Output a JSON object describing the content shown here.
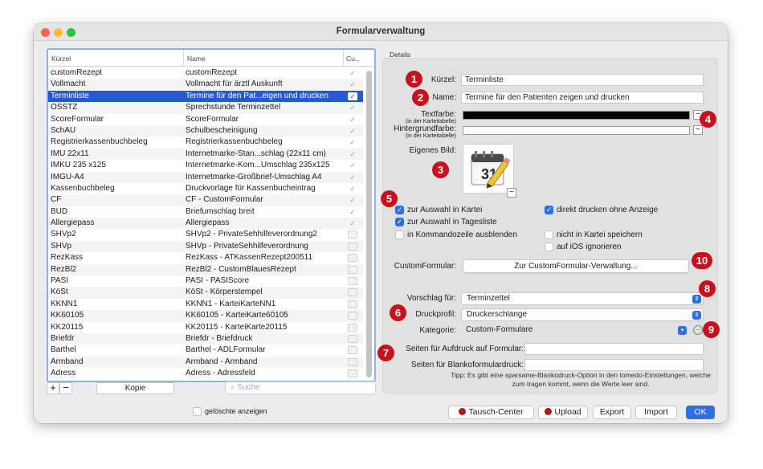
{
  "window": {
    "title": "Formularverwaltung"
  },
  "colors": {
    "close": "#fe5f57",
    "minimize": "#febc2e",
    "zoom": "#28c840",
    "accent": "#2f6fe0",
    "badge": "#c8101f",
    "selected_row": "#2558d6"
  },
  "table": {
    "headers": {
      "kuerzel": "Kürzel",
      "name": "Name",
      "cu": "Cu..."
    },
    "rows": [
      {
        "k": "customRezept",
        "n": "customRezept",
        "c": true
      },
      {
        "k": "Vollmacht",
        "n": "Vollmacht für ärztl Auskunft",
        "c": true
      },
      {
        "k": "Terminliste",
        "n": "Termine für den Pat...eigen und drucken",
        "c": true,
        "selected": true
      },
      {
        "k": "OSSTZ",
        "n": "Sprechstunde Terminzettel",
        "c": true
      },
      {
        "k": "ScoreFormular",
        "n": "ScoreFormular",
        "c": true
      },
      {
        "k": "SchAU",
        "n": "Schulbescheinigung",
        "c": true
      },
      {
        "k": "Registrierkassenbuchbeleg",
        "n": "Registrierkassenbuchbeleg",
        "c": true
      },
      {
        "k": "IMU 22x11",
        "n": "Internetmarke-Stan...schlag (22x11 cm)",
        "c": true
      },
      {
        "k": "IMKU 235 x125",
        "n": "Internetmarke-Kom...Umschlag 235x125",
        "c": true
      },
      {
        "k": "IMGU-A4",
        "n": "Internetmarke-Großbrief-Umschlag A4",
        "c": true
      },
      {
        "k": "Kassenbuchbeleg",
        "n": "Druckvorlage für Kassenbucheintrag",
        "c": true
      },
      {
        "k": "CF",
        "n": "CF - CustomFormular",
        "c": true
      },
      {
        "k": "BUD",
        "n": "Briefumschlag breit",
        "c": true
      },
      {
        "k": "Allergiepass",
        "n": "Allergiepass",
        "c": true
      },
      {
        "k": "SHVp2",
        "n": "SHVp2 - PrivateSehhilfeverordnung2",
        "c": false
      },
      {
        "k": "SHVp",
        "n": "SHVp - PrivateSehhilfeverordnung",
        "c": false
      },
      {
        "k": "RezKass",
        "n": "RezKass - ATKassenRezept200511",
        "c": false
      },
      {
        "k": "RezBl2",
        "n": "RezBl2 - CustomBlauesRezept",
        "c": false
      },
      {
        "k": "PASI",
        "n": "PASI - PASIScore",
        "c": false
      },
      {
        "k": "KöSt",
        "n": "KöSt - Körperstempel",
        "c": false
      },
      {
        "k": "KKNN1",
        "n": "KKNN1 - KarteiKarteNN1",
        "c": false
      },
      {
        "k": "KK60105",
        "n": "KK60105 - KarteiKarte60105",
        "c": false
      },
      {
        "k": "KK20115",
        "n": "KK20115 - KarteiKarte20115",
        "c": false
      },
      {
        "k": "Briefdr",
        "n": "Briefdr - Briefdruck",
        "c": false
      },
      {
        "k": "Barthel",
        "n": "Barthel - ADLFormular",
        "c": false
      },
      {
        "k": "Armband",
        "n": "Armband - Armband",
        "c": false
      },
      {
        "k": "Adress",
        "n": "Adress - Adressfeld",
        "c": false
      }
    ]
  },
  "list_controls": {
    "add": "+",
    "remove": "−",
    "copy": "Kopie",
    "search_placeholder": "Suche",
    "show_deleted": "gelöschte anzeigen"
  },
  "details": {
    "section_label": "Details",
    "kuerzel_label": "Kürzel:",
    "kuerzel_value": "Terminliste",
    "name_label": "Name:",
    "name_value": "Termine für den Patienten zeigen und drucken",
    "textfarbe_label": "Textfarbe:",
    "textfarbe_sub": "(in der Karteitabelle)",
    "textfarbe_color": "#000000",
    "hintergrund_label": "Hintergrundfarbe:",
    "hintergrund_sub": "(in der Karteitabelle)",
    "hintergrund_color": "#ffffff",
    "bild_label": "Eigenes Bild:",
    "calendar_day": "31",
    "checkboxes": {
      "auswahl_kartei": {
        "label": "zur Auswahl in Kartei",
        "checked": true
      },
      "auswahl_tagesliste": {
        "label": "zur Auswahl in Tagesliste",
        "checked": true
      },
      "kommandozeile": {
        "label": "in Kommandozeile ausblenden",
        "checked": false
      },
      "direkt_drucken": {
        "label": "direkt drucken ohne Anzeige",
        "checked": true
      },
      "nicht_speichern": {
        "label": "nicht in Kartei speichern",
        "checked": false
      },
      "ios": {
        "label": "auf iOS ignorieren",
        "checked": false
      }
    },
    "customformular_label": "CustomFormular:",
    "customformular_button": "Zur CustomFormular-Verwaltung...",
    "vorschlag_label": "Vorschlag für:",
    "vorschlag_value": "Terminzettel",
    "druckprofil_label": "Druckprofil:",
    "druckprofil_value": "Druckerschlange",
    "kategorie_label": "Kategorie:",
    "kategorie_value": "Custom-Formulare",
    "seiten_aufdruck_label": "Seiten für Aufdruck auf Formular:",
    "seiten_aufdruck_value": "",
    "seiten_blanko_label": "Seiten für Blankoformulardruck:",
    "seiten_blanko_value": "",
    "tip": "Tipp: Es gibt eine sparsame-Blankodruck-Option in den tomedo-Einstellungen, welche zum tragen kommt, wenn die Werte leer sind."
  },
  "badges": [
    "1",
    "2",
    "3",
    "4",
    "5",
    "6",
    "7",
    "8",
    "9",
    "10"
  ],
  "footer": {
    "tausch": "Tausch-Center",
    "upload": "Upload",
    "export": "Export",
    "import": "Import",
    "ok": "OK"
  }
}
